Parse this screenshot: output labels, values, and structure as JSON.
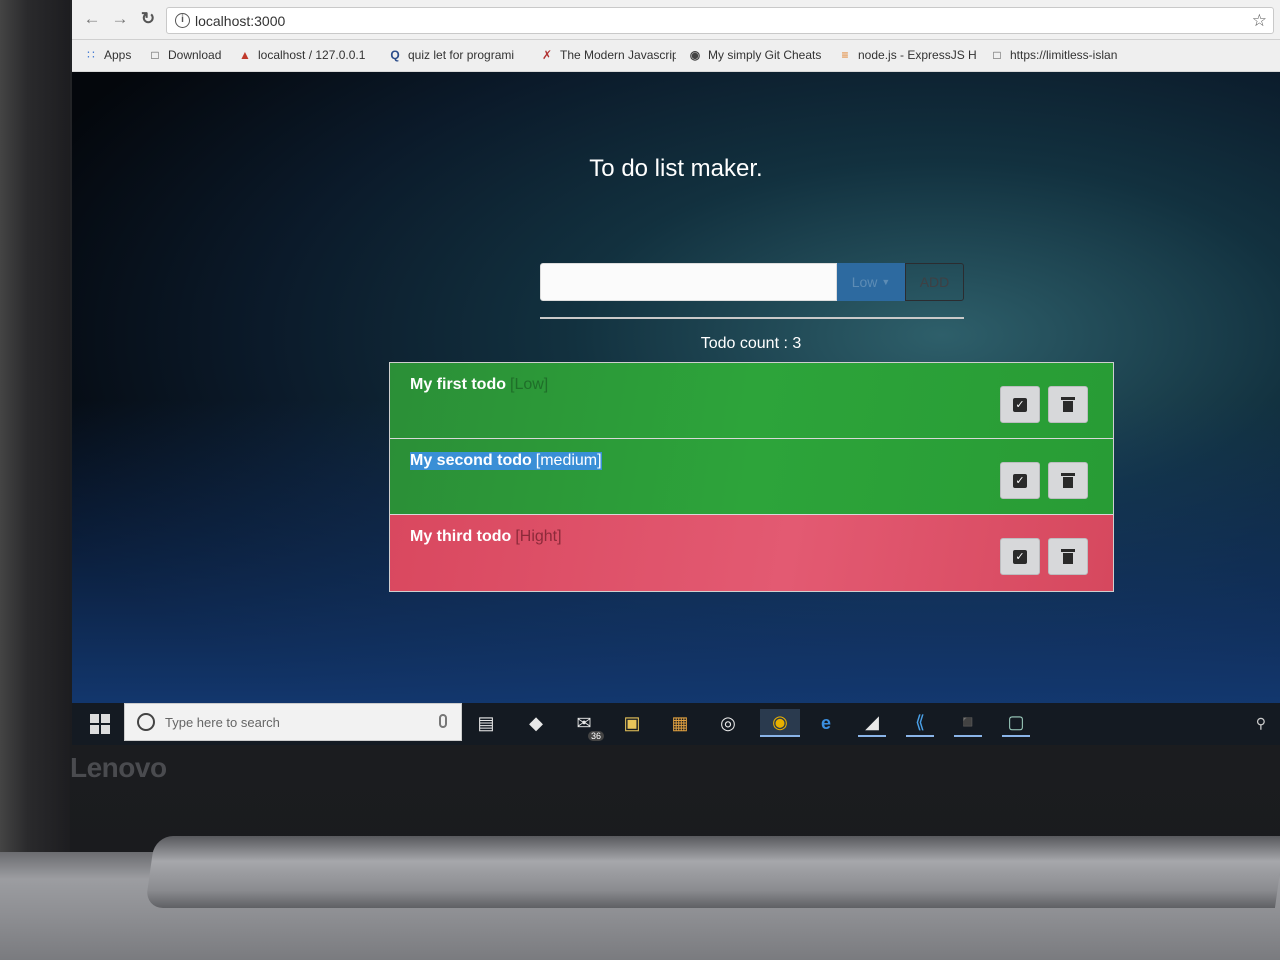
{
  "browser": {
    "url": "localhost:3000",
    "bookmarks": [
      {
        "label": "Apps",
        "icon": "apps-grid-icon"
      },
      {
        "label": "Download",
        "icon": "page-icon"
      },
      {
        "label": "localhost / 127.0.0.1",
        "icon": "phpmyadmin-icon"
      },
      {
        "label": "quiz let for programi",
        "icon": "quizlet-icon"
      },
      {
        "label": "The Modern Javascrip",
        "icon": "javascript-icon"
      },
      {
        "label": "My simply Git Cheats",
        "icon": "github-icon"
      },
      {
        "label": "node.js - ExpressJS H",
        "icon": "stackoverflow-icon"
      },
      {
        "label": "https://limitless-islan",
        "icon": "page-icon"
      }
    ]
  },
  "app": {
    "title": "To do list maker.",
    "input_placeholder": "",
    "priority_selected": "Low",
    "add_label": "ADD",
    "count_label": "Todo count : 3",
    "todos": [
      {
        "text": "My first todo",
        "priority": "[Low]",
        "color": "#2da43a"
      },
      {
        "text": "My second todo",
        "priority": "[medium]",
        "color": "#2da43a"
      },
      {
        "text": "My third todo",
        "priority": "[Hight]",
        "color": "#e35a72"
      }
    ]
  },
  "taskbar": {
    "search_placeholder": "Type here to search",
    "mail_badge": "36"
  },
  "device": {
    "brand": "Lenovo"
  }
}
